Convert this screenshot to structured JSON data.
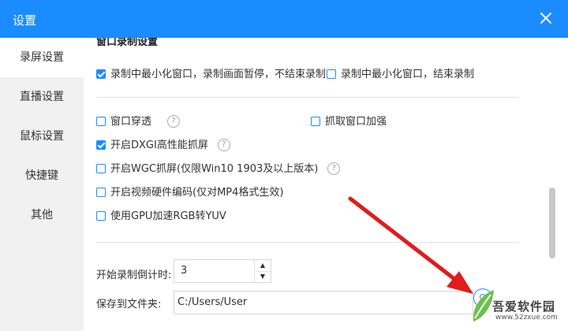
{
  "window": {
    "title": "设置"
  },
  "sidebar": {
    "items": [
      {
        "label": "录屏设置",
        "active": true
      },
      {
        "label": "直播设置"
      },
      {
        "label": "鼠标设置"
      },
      {
        "label": "快捷键"
      },
      {
        "label": "其他"
      }
    ]
  },
  "content": {
    "cut_heading": "窗口录制设置",
    "window_record": [
      {
        "label": "录制中最小化窗口，录制画面暂停，不结束录制",
        "checked": true
      },
      {
        "label": "录制中最小化窗口，结束录制",
        "checked": false
      }
    ],
    "options": {
      "window_penetrate": {
        "label": "窗口穿透",
        "checked": false,
        "help": "?"
      },
      "capture_enhance": {
        "label": "抓取窗口加强",
        "checked": false
      },
      "dxgi": {
        "label": "开启DXGI高性能抓屏",
        "checked": true,
        "help": "?"
      },
      "wgc": {
        "label": "开启WGC抓屏(仅限Win10 1903及以上版本)",
        "checked": false,
        "help": "?"
      },
      "hw_encode": {
        "label": "开启视频硬件编码(仅对MP4格式生效)",
        "checked": false
      },
      "gpu_rgb": {
        "label": "使用GPU加速RGB转YUV",
        "checked": false
      }
    },
    "countdown": {
      "label": "开始录制倒计时:",
      "value": "3",
      "up": "▲",
      "down": "▼"
    },
    "save_to": {
      "label": "保存到文件夹:",
      "path": "C:/Users/User"
    }
  },
  "watermark": {
    "text": "吾爱软件园",
    "url": "www.52zxue.com"
  },
  "colors": {
    "accent": "#1a8cff",
    "arrow": "#e21b1b",
    "sidebar_bg": "#f1f1f1"
  }
}
